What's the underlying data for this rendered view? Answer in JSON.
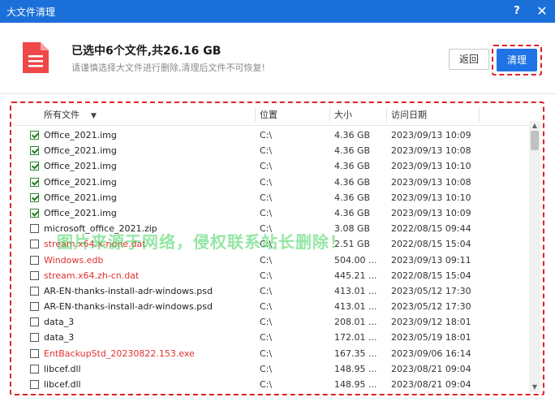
{
  "window": {
    "title": "大文件清理",
    "help_label": "?",
    "close_label": "✕"
  },
  "header": {
    "summary": "已选中6个文件,共26.16 GB",
    "hint": "请谨慎选择大文件进行删除,清理后文件不可恢复!",
    "back_label": "返回",
    "clean_label": "清理"
  },
  "table": {
    "columns": {
      "name": "所有文件",
      "location": "位置",
      "size": "大小",
      "date": "访问日期"
    },
    "rows": [
      {
        "checked": true,
        "red": false,
        "name": "Office_2021.img",
        "location": "C:\\",
        "size": "4.36 GB",
        "date": "2023/09/13 10:09"
      },
      {
        "checked": true,
        "red": false,
        "name": "Office_2021.img",
        "location": "C:\\",
        "size": "4.36 GB",
        "date": "2023/09/13 10:08"
      },
      {
        "checked": true,
        "red": false,
        "name": "Office_2021.img",
        "location": "C:\\",
        "size": "4.36 GB",
        "date": "2023/09/13 10:10"
      },
      {
        "checked": true,
        "red": false,
        "name": "Office_2021.img",
        "location": "C:\\",
        "size": "4.36 GB",
        "date": "2023/09/13 10:08"
      },
      {
        "checked": true,
        "red": false,
        "name": "Office_2021.img",
        "location": "C:\\",
        "size": "4.36 GB",
        "date": "2023/09/13 10:10"
      },
      {
        "checked": true,
        "red": false,
        "name": "Office_2021.img",
        "location": "C:\\",
        "size": "4.36 GB",
        "date": "2023/09/13 10:09"
      },
      {
        "checked": false,
        "red": false,
        "name": "microsoft_office_2021.zip",
        "location": "C:\\",
        "size": "3.08 GB",
        "date": "2022/08/15 09:44"
      },
      {
        "checked": false,
        "red": true,
        "name": "stream.x64.x-none.dat",
        "location": "C:\\",
        "size": "2.51 GB",
        "date": "2022/08/15 15:04"
      },
      {
        "checked": false,
        "red": true,
        "name": "Windows.edb",
        "location": "C:\\",
        "size": "504.00 ...",
        "date": "2023/09/13 09:11"
      },
      {
        "checked": false,
        "red": true,
        "name": "stream.x64.zh-cn.dat",
        "location": "C:\\",
        "size": "445.21 ...",
        "date": "2022/08/15 15:04"
      },
      {
        "checked": false,
        "red": false,
        "name": "AR-EN-thanks-install-adr-windows.psd",
        "location": "C:\\",
        "size": "413.01 ...",
        "date": "2023/05/12 17:30"
      },
      {
        "checked": false,
        "red": false,
        "name": "AR-EN-thanks-install-adr-windows.psd",
        "location": "C:\\",
        "size": "413.01 ...",
        "date": "2023/05/12 17:30"
      },
      {
        "checked": false,
        "red": false,
        "name": "data_3",
        "location": "C:\\",
        "size": "208.01 ...",
        "date": "2023/09/12 18:01"
      },
      {
        "checked": false,
        "red": false,
        "name": "data_3",
        "location": "C:\\",
        "size": "172.01 ...",
        "date": "2023/05/19 18:01"
      },
      {
        "checked": false,
        "red": true,
        "name": "EntBackupStd_20230822.153.exe",
        "location": "C:\\",
        "size": "167.35 ...",
        "date": "2023/09/06 16:14"
      },
      {
        "checked": false,
        "red": false,
        "name": "libcef.dll",
        "location": "C:\\",
        "size": "148.95 ...",
        "date": "2023/08/21 09:04"
      },
      {
        "checked": false,
        "red": false,
        "name": "libcef.dll",
        "location": "C:\\",
        "size": "148.95 ...",
        "date": "2023/08/21 09:04"
      }
    ]
  },
  "watermark": "图片来源于网络，侵权联系站长删除！",
  "colors": {
    "titlebar": "#1b6fd9",
    "primary_button": "#1f73e6",
    "highlight_border": "#e0202a",
    "warning_text": "#e23030",
    "checkbox_check": "#1e7f1e"
  },
  "icons": {
    "file": "document-icon",
    "sort": "sort-down-icon",
    "scroll_up": "scroll-up-icon",
    "scroll_down": "scroll-down-icon"
  }
}
